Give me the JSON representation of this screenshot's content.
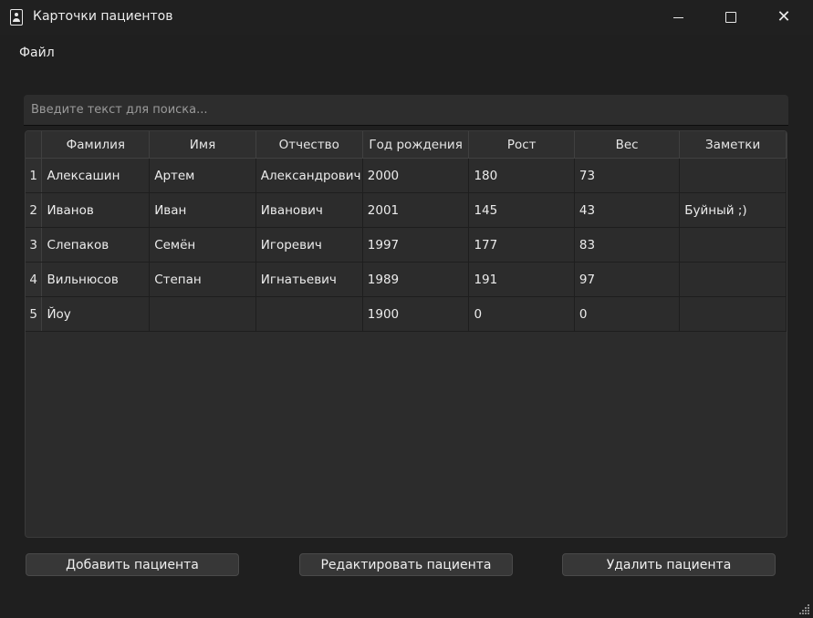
{
  "window": {
    "title": "Карточки пациентов",
    "minimize_label": "",
    "close_glyph": "✕"
  },
  "menu": {
    "file": "Файл"
  },
  "search": {
    "placeholder": "Введите текст для поиска...",
    "value": ""
  },
  "table": {
    "columns": [
      "Фамилия",
      "Имя",
      "Отчество",
      "Год рождения",
      "Рост",
      "Вес",
      "Заметки"
    ],
    "rows": [
      {
        "num": "1",
        "cells": [
          "Алексашин",
          "Артем",
          "Александрович",
          "2000",
          "180",
          "73",
          ""
        ]
      },
      {
        "num": "2",
        "cells": [
          "Иванов",
          "Иван",
          "Иванович",
          "2001",
          "145",
          "43",
          "Буйный ;)"
        ]
      },
      {
        "num": "3",
        "cells": [
          "Слепаков",
          "Семён",
          "Игоревич",
          "1997",
          "177",
          "83",
          ""
        ]
      },
      {
        "num": "4",
        "cells": [
          "Вильнюсов",
          "Степан",
          "Игнатьевич",
          "1989",
          "191",
          "97",
          ""
        ]
      },
      {
        "num": "5",
        "cells": [
          "Йоу",
          "",
          "",
          "1900",
          "0",
          "0",
          ""
        ]
      }
    ]
  },
  "buttons": {
    "add": "Добавить пациента",
    "edit": "Редактировать пациента",
    "delete": "Удалить пациента"
  }
}
